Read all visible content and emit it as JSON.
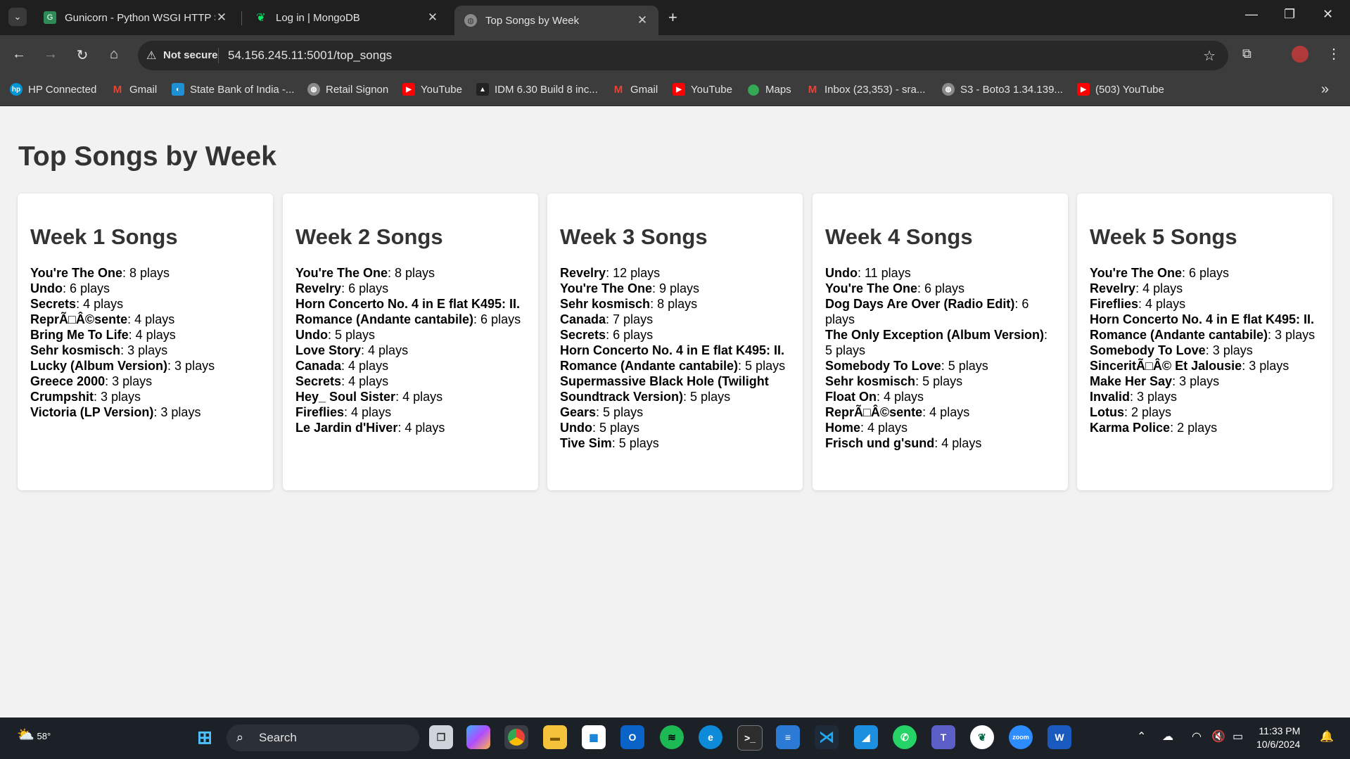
{
  "browser": {
    "tabs": [
      {
        "title": "Gunicorn - Python WSGI HTTP S",
        "favicon": "gunicorn-icon",
        "active": false
      },
      {
        "title": "Log in | MongoDB",
        "favicon": "mongodb-leaf-icon",
        "active": false
      },
      {
        "title": "Top Songs by Week",
        "favicon": "globe-icon",
        "active": true
      }
    ],
    "address": {
      "security_label": "Not secure",
      "url": "54.156.245.11:5001/top_songs"
    },
    "bookmarks": [
      {
        "label": "HP Connected",
        "icon": "hp-icon"
      },
      {
        "label": "Gmail",
        "icon": "gmail-icon"
      },
      {
        "label": "State Bank of India -...",
        "icon": "sbi-icon"
      },
      {
        "label": "Retail Signon",
        "icon": "globe-icon"
      },
      {
        "label": "YouTube",
        "icon": "youtube-icon"
      },
      {
        "label": "IDM 6.30 Build 8 inc...",
        "icon": "idm-icon"
      },
      {
        "label": "Gmail",
        "icon": "gmail-icon"
      },
      {
        "label": "YouTube",
        "icon": "youtube-icon"
      },
      {
        "label": "Maps",
        "icon": "maps-icon"
      },
      {
        "label": "Inbox (23,353) - sra...",
        "icon": "gmail-icon"
      },
      {
        "label": "S3 - Boto3 1.34.139...",
        "icon": "globe-icon"
      },
      {
        "label": "(503) YouTube",
        "icon": "youtube-icon"
      }
    ]
  },
  "page": {
    "title": "Top Songs by Week",
    "weeks": [
      {
        "heading": "Week 1 Songs",
        "songs": [
          {
            "name": "You're The One",
            "plays": ": 8 plays"
          },
          {
            "name": "Undo",
            "plays": ": 6 plays"
          },
          {
            "name": "Secrets",
            "plays": ": 4 plays"
          },
          {
            "name": "ReprÃ□Â©sente",
            "plays": ": 4 plays"
          },
          {
            "name": "Bring Me To Life",
            "plays": ": 4 plays"
          },
          {
            "name": "Sehr kosmisch",
            "plays": ": 3 plays"
          },
          {
            "name": "Lucky (Album Version)",
            "plays": ": 3 plays"
          },
          {
            "name": "Greece 2000",
            "plays": ": 3 plays"
          },
          {
            "name": "Crumpshit",
            "plays": ": 3 plays"
          },
          {
            "name": "Victoria (LP Version)",
            "plays": ": 3 plays"
          }
        ]
      },
      {
        "heading": "Week 2 Songs",
        "songs": [
          {
            "name": "You're The One",
            "plays": ": 8 plays"
          },
          {
            "name": "Revelry",
            "plays": ": 6 plays"
          },
          {
            "name": "Horn Concerto No. 4 in E flat K495: II. Romance (Andante cantabile)",
            "plays": ": 6 plays"
          },
          {
            "name": "Undo",
            "plays": ": 5 plays"
          },
          {
            "name": "Love Story",
            "plays": ": 4 plays"
          },
          {
            "name": "Canada",
            "plays": ": 4 plays"
          },
          {
            "name": "Secrets",
            "plays": ": 4 plays"
          },
          {
            "name": "Hey_ Soul Sister",
            "plays": ": 4 plays"
          },
          {
            "name": "Fireflies",
            "plays": ": 4 plays"
          },
          {
            "name": "Le Jardin d'Hiver",
            "plays": ": 4 plays"
          }
        ]
      },
      {
        "heading": "Week 3 Songs",
        "songs": [
          {
            "name": "Revelry",
            "plays": ": 12 plays"
          },
          {
            "name": "You're The One",
            "plays": ": 9 plays"
          },
          {
            "name": "Sehr kosmisch",
            "plays": ": 8 plays"
          },
          {
            "name": "Canada",
            "plays": ": 7 plays"
          },
          {
            "name": "Secrets",
            "plays": ": 6 plays"
          },
          {
            "name": "Horn Concerto No. 4 in E flat K495: II. Romance (Andante cantabile)",
            "plays": ": 5 plays"
          },
          {
            "name": "Supermassive Black Hole (Twilight Soundtrack Version)",
            "plays": ": 5 plays"
          },
          {
            "name": "Gears",
            "plays": ": 5 plays"
          },
          {
            "name": "Undo",
            "plays": ": 5 plays"
          },
          {
            "name": "Tive Sim",
            "plays": ": 5 plays"
          }
        ]
      },
      {
        "heading": "Week 4 Songs",
        "songs": [
          {
            "name": "Undo",
            "plays": ": 11 plays"
          },
          {
            "name": "You're The One",
            "plays": ": 6 plays"
          },
          {
            "name": "Dog Days Are Over (Radio Edit)",
            "plays": ": 6 plays"
          },
          {
            "name": "The Only Exception (Album Version)",
            "plays": ": 5 plays"
          },
          {
            "name": "Somebody To Love",
            "plays": ": 5 plays"
          },
          {
            "name": "Sehr kosmisch",
            "plays": ": 5 plays"
          },
          {
            "name": "Float On",
            "plays": ": 4 plays"
          },
          {
            "name": "ReprÃ□Â©sente",
            "plays": ": 4 plays"
          },
          {
            "name": "Home",
            "plays": ": 4 plays"
          },
          {
            "name": "Frisch und g'sund",
            "plays": ": 4 plays"
          }
        ]
      },
      {
        "heading": "Week 5 Songs",
        "songs": [
          {
            "name": "You're The One",
            "plays": ": 6 plays"
          },
          {
            "name": "Revelry",
            "plays": ": 4 plays"
          },
          {
            "name": "Fireflies",
            "plays": ": 4 plays"
          },
          {
            "name": "Horn Concerto No. 4 in E flat K495: II. Romance (Andante cantabile)",
            "plays": ": 3 plays"
          },
          {
            "name": "Somebody To Love",
            "plays": ": 3 plays"
          },
          {
            "name": "SinceritÃ□Â© Et Jalousie",
            "plays": ": 3 plays"
          },
          {
            "name": "Make Her Say",
            "plays": ": 3 plays"
          },
          {
            "name": "Invalid",
            "plays": ": 3 plays"
          },
          {
            "name": "Lotus",
            "plays": ": 2 plays"
          },
          {
            "name": "Karma Police",
            "plays": ": 2 plays"
          }
        ]
      }
    ]
  },
  "taskbar": {
    "weather": "58°",
    "search_label": "Search",
    "apps": [
      "windows-start-icon",
      "task-view-icon",
      "copilot-icon",
      "chrome-icon",
      "file-explorer-icon",
      "store-icon",
      "outlook-icon",
      "spotify-icon",
      "edge-icon",
      "terminal-icon",
      "notepad-icon",
      "vscode-icon",
      "paint-icon",
      "whatsapp-icon",
      "teams-icon",
      "mongodb-compass-icon",
      "zoom-icon",
      "word-icon"
    ],
    "time": "11:33 PM",
    "date": "10/6/2024"
  }
}
